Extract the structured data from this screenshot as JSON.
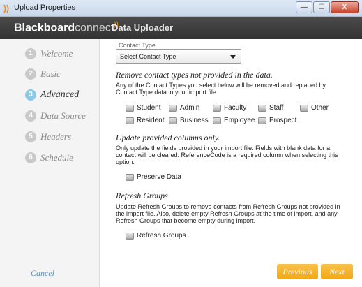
{
  "window": {
    "title": "Upload Properties",
    "min_glyph": "—",
    "max_glyph": "☐",
    "close_glyph": "X"
  },
  "header": {
    "brand_bold": "Blackboard",
    "brand_light": "connect",
    "brand_mark": "))",
    "page_title": "Data Uploader"
  },
  "sidebar": {
    "steps": [
      {
        "num": "1",
        "label": "Welcome"
      },
      {
        "num": "2",
        "label": "Basic"
      },
      {
        "num": "3",
        "label": "Advanced"
      },
      {
        "num": "4",
        "label": "Data Source"
      },
      {
        "num": "5",
        "label": "Headers"
      },
      {
        "num": "6",
        "label": "Schedule"
      }
    ],
    "active_step": "Advanced",
    "cancel_label": "Cancel"
  },
  "main": {
    "contact_type_label": "Contact Type",
    "contact_type_value": "Select Contact Type",
    "remove": {
      "heading": "Remove contact types not provided in the data.",
      "desc": "Any of the Contact Types you select below will be removed and replaced by Contact Type data in your import file.",
      "options": [
        "Student",
        "Admin",
        "Faculty",
        "Staff",
        "Other",
        "Resident",
        "Business",
        "Employee",
        "Prospect"
      ]
    },
    "update": {
      "heading": "Update provided columns only.",
      "desc": "Only update the fields provided in your import file. Fields with blank data for a contact will be cleared. ReferenceCode is a required column when selecting this option.",
      "option": "Preserve Data"
    },
    "refresh": {
      "heading": "Refresh Groups",
      "desc": "Update Refresh Groups to remove contacts from Refresh Groups not provided in the import file. Also, delete empty Refresh Groups at the time of import, and any Refresh Groups that become empty during import.",
      "option": "Refresh Groups"
    }
  },
  "footer": {
    "previous_label": "Previous",
    "next_label": "Next"
  },
  "colors": {
    "accent": "#f2a812",
    "active_step": "#8cc9e6",
    "brand_mark": "#f0a000"
  }
}
